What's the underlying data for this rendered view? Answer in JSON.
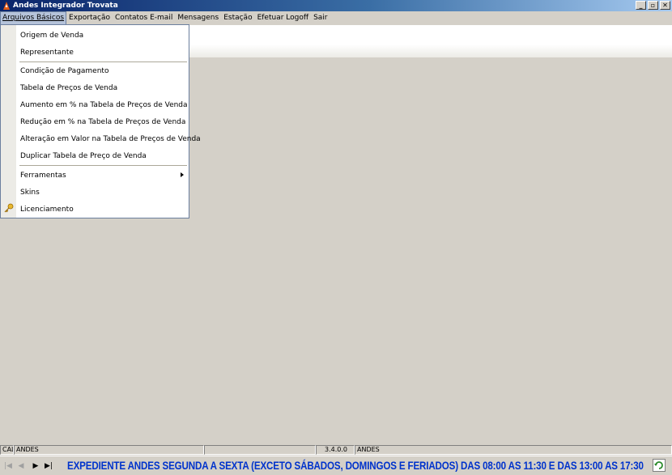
{
  "window": {
    "title": "Andes Integrador Trovata"
  },
  "menubar": {
    "items": [
      {
        "label": "Arquivos Básicos"
      },
      {
        "label": "Exportação"
      },
      {
        "label": "Contatos E-mail"
      },
      {
        "label": "Mensagens"
      },
      {
        "label": "Estação"
      },
      {
        "label": "Efetuar Logoff"
      },
      {
        "label": "Sair"
      }
    ]
  },
  "dropdown": {
    "items": [
      {
        "label": "Origem de Venda"
      },
      {
        "label": "Representante"
      },
      {
        "label": "Condição de Pagamento"
      },
      {
        "label": "Tabela de Preços de Venda"
      },
      {
        "label": "Aumento  em % na Tabela de Preços de Venda"
      },
      {
        "label": "Redução em % na Tabela de Preços de Venda"
      },
      {
        "label": "Alteração em Valor na Tabela de Preços de Venda"
      },
      {
        "label": "Duplicar Tabela de Preço de Venda"
      },
      {
        "label": "Ferramentas"
      },
      {
        "label": "Skins"
      },
      {
        "label": "Licenciamento"
      }
    ]
  },
  "status": {
    "panel1": "CAL",
    "panel2": "ANDES",
    "panel3": "",
    "version": "3.4.0.0",
    "user": "ANDES"
  },
  "bottom": {
    "message": "EXPEDIENTE ANDES SEGUNDA A SEXTA (EXCETO SÁBADOS, DOMINGOS E FERIADOS) DAS 08:00 AS 11:30 E DAS 13:00 AS 17:30"
  },
  "colors": {
    "accent": "#0a246a",
    "marquee": "#0033cc",
    "menu_highlight": "#b5c3da"
  }
}
